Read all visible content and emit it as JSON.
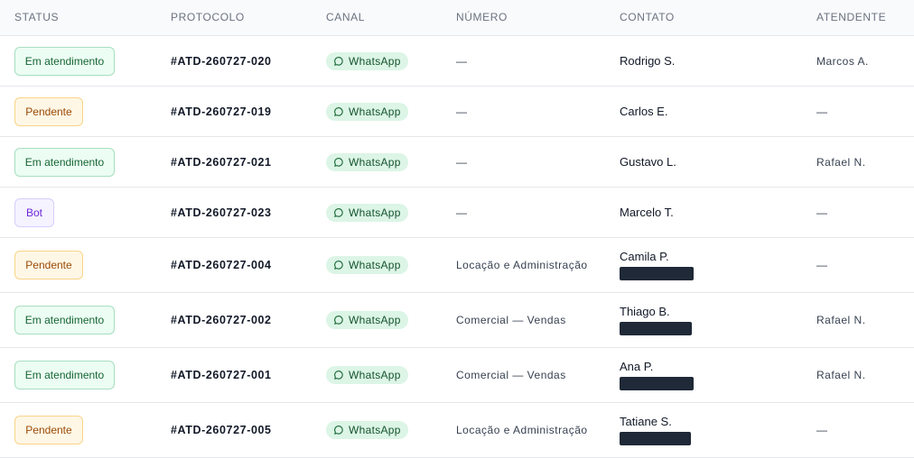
{
  "columns": {
    "status": "STATUS",
    "protocol": "PROTOCOLO",
    "channel": "CANAL",
    "number": "NÚMERO",
    "contact": "CONTATO",
    "agent": "ATENDENTE"
  },
  "colors": {
    "accent_green": "#ecfdf3",
    "pending_amber": "#fff7e6",
    "bot_purple": "#f5f3ff",
    "whatsapp_chip": "#dcf5e6"
  },
  "rows": [
    {
      "status": "Em atendimento",
      "status_kind": "green",
      "protocol": "#ATD-260727-020",
      "channel": "WhatsApp",
      "channel_icon": "whatsapp-icon",
      "number": "—",
      "contact": "Rodrigo S.",
      "redacted": false,
      "agent": "Marcos A."
    },
    {
      "status": "Pendente",
      "status_kind": "amber",
      "protocol": "#ATD-260727-019",
      "channel": "WhatsApp",
      "channel_icon": "whatsapp-icon",
      "number": "—",
      "contact": "Carlos E.",
      "redacted": false,
      "agent": "—"
    },
    {
      "status": "Em atendimento",
      "status_kind": "green",
      "protocol": "#ATD-260727-021",
      "channel": "WhatsApp",
      "channel_icon": "whatsapp-icon",
      "number": "—",
      "contact": "Gustavo L.",
      "redacted": false,
      "agent": "Rafael N."
    },
    {
      "status": "Bot",
      "status_kind": "purple",
      "protocol": "#ATD-260727-023",
      "channel": "WhatsApp",
      "channel_icon": "whatsapp-icon",
      "number": "—",
      "contact": "Marcelo T.",
      "redacted": false,
      "agent": "—"
    },
    {
      "status": "Pendente",
      "status_kind": "amber",
      "protocol": "#ATD-260727-004",
      "channel": "WhatsApp",
      "channel_icon": "whatsapp-icon",
      "number": "Locação e Administração",
      "contact": "Camila P.",
      "redacted": true,
      "agent": "—"
    },
    {
      "status": "Em atendimento",
      "status_kind": "green",
      "protocol": "#ATD-260727-002",
      "channel": "WhatsApp",
      "channel_icon": "whatsapp-icon",
      "number": "Comercial — Vendas",
      "contact": "Thiago B.",
      "redacted": true,
      "agent": "Rafael N."
    },
    {
      "status": "Em atendimento",
      "status_kind": "green",
      "protocol": "#ATD-260727-001",
      "channel": "WhatsApp",
      "channel_icon": "whatsapp-icon",
      "number": "Comercial — Vendas",
      "contact": "Ana P.",
      "redacted": true,
      "agent": "Rafael N."
    },
    {
      "status": "Pendente",
      "status_kind": "amber",
      "protocol": "#ATD-260727-005",
      "channel": "WhatsApp",
      "channel_icon": "whatsapp-icon",
      "number": "Locação e Administração",
      "contact": "Tatiane S.",
      "redacted": true,
      "agent": "—"
    }
  ]
}
